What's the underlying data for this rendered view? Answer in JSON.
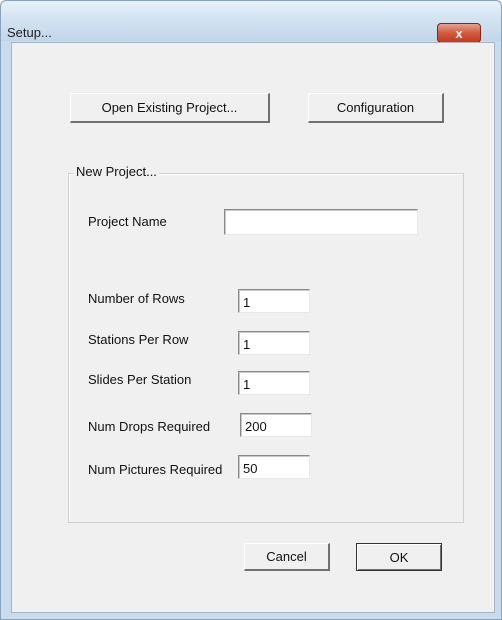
{
  "window": {
    "title": "Setup...",
    "close_glyph": "x"
  },
  "buttons": {
    "open_existing": "Open Existing Project...",
    "configuration": "Configuration",
    "cancel": "Cancel",
    "ok": "OK"
  },
  "new_project": {
    "legend": "New Project...",
    "project_name_label": "Project Name",
    "project_name_value": "",
    "fields": [
      {
        "label": "Number of Rows",
        "value": "1"
      },
      {
        "label": "Stations Per Row",
        "value": "1"
      },
      {
        "label": "Slides Per Station",
        "value": "1"
      },
      {
        "label": "Num Drops Required",
        "value": "200"
      },
      {
        "label": "Num Pictures  Required",
        "value": "50"
      }
    ]
  },
  "colors": {
    "frame": "#c9dced",
    "client": "#f0f0f0",
    "close_button": "#d45a3f"
  }
}
